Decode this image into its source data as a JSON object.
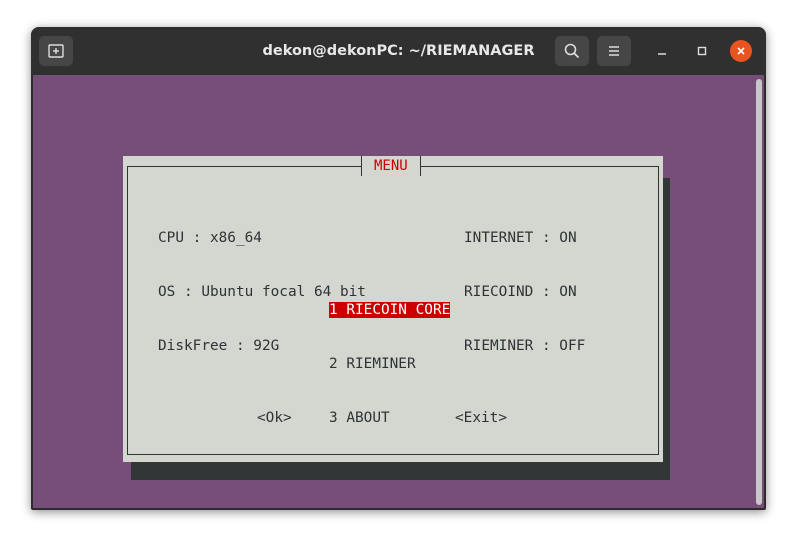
{
  "window": {
    "title": "dekon@dekonPC: ~/RIEMANAGER",
    "new_tab_icon": "new-tab-icon",
    "search_icon": "search-icon",
    "menu_icon": "hamburger-menu-icon",
    "minimize_icon": "minimize-icon",
    "maximize_icon": "maximize-icon",
    "close_icon": "close-icon",
    "close_color": "#e95420"
  },
  "terminal": {
    "background": "#764e79"
  },
  "dialog": {
    "title": "MENU",
    "info_left": [
      "CPU : x86_64",
      "OS : Ubuntu focal 64 bit",
      "DiskFree : 92G"
    ],
    "info_right": [
      "INTERNET : ON",
      "RIECOIND : ON",
      "RIEMINER : OFF"
    ],
    "menu_items": [
      {
        "label": "1 RIECOIN CORE",
        "selected": true
      },
      {
        "label": "2 RIEMINER",
        "selected": false
      },
      {
        "label": "3 ABOUT",
        "selected": false
      }
    ],
    "ok_label": "<Ok>",
    "exit_label": "<Exit>",
    "highlight_color": "#cc0000"
  }
}
